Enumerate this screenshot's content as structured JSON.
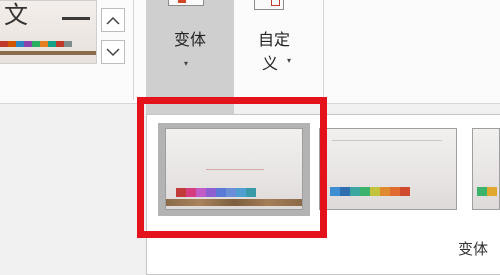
{
  "theme": {
    "glyph": "文",
    "swatches": [
      "#c0392b",
      "#d35400",
      "#2e86c1",
      "#8e44ad",
      "#27ae60",
      "#e67e22",
      "#16a085",
      "#c0392b",
      "#7f8c8d"
    ]
  },
  "ribbon": {
    "variants_label": "变体",
    "custom_label_line1": "自定",
    "custom_label_line2": "义",
    "caret": "▾"
  },
  "icons": {
    "scroll_up": "chevron-up-icon",
    "scroll_down": "chevron-down-icon",
    "variants": "variants-icon",
    "custom": "customize-icon"
  },
  "gallery": {
    "footer_label": "变体",
    "tile1_swatches": [
      "#c23b3b",
      "#d63c7f",
      "#c15cc7",
      "#8e5fd1",
      "#5a7ad6",
      "#6a8fd6",
      "#4fa0d0",
      "#3a9aa8"
    ],
    "tile2_swatches": [
      "#3d8fd1",
      "#2f6fb0",
      "#3ca7a0",
      "#3bb36b",
      "#c2c23c",
      "#e08a2f",
      "#e06a2f",
      "#d04a2f"
    ]
  },
  "colors": {
    "highlight": "#e4131b",
    "active_group": "#cfcfcf"
  }
}
